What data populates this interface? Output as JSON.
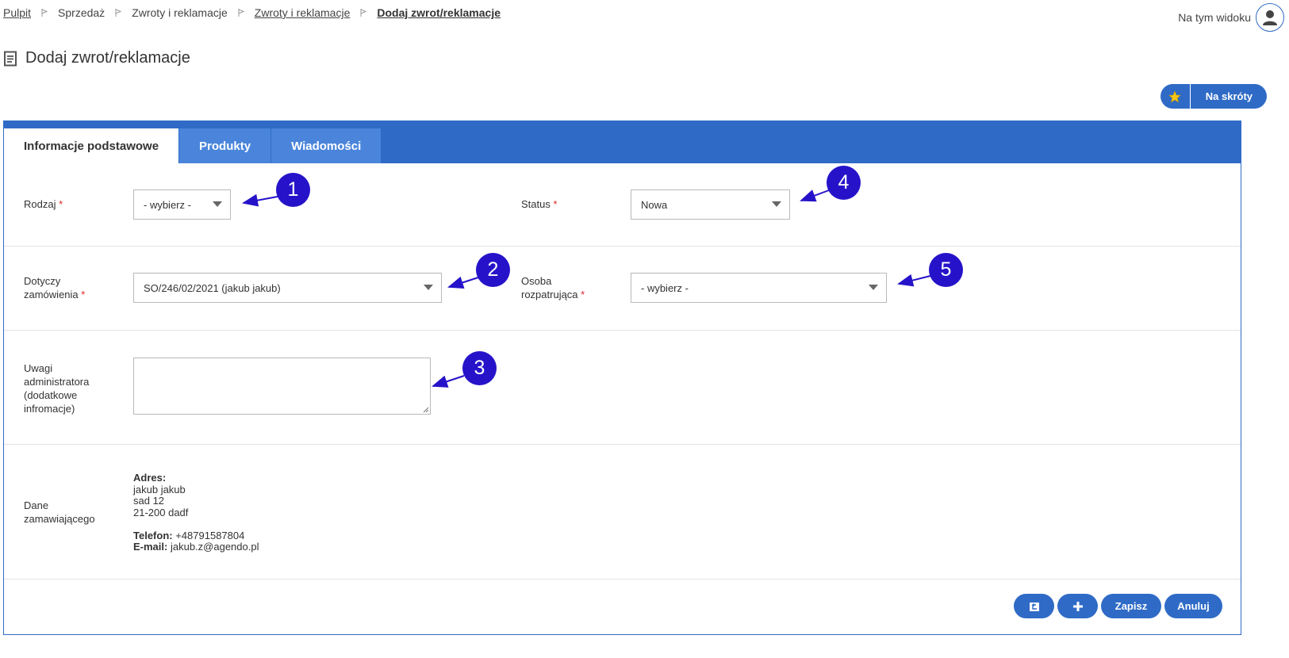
{
  "breadcrumb": {
    "items": [
      {
        "label": "Pulpit"
      },
      {
        "label": "Sprzedaż"
      },
      {
        "label": "Zwroty i reklamacje"
      },
      {
        "label": "Zwroty i reklamacje"
      },
      {
        "label": "Dodaj zwrot/reklamacje"
      }
    ]
  },
  "header": {
    "view_label": "Na tym widoku",
    "avatar_icon": "user-icon",
    "title": "Dodaj zwrot/reklamacje",
    "title_icon": "document-icon"
  },
  "shortcuts": {
    "label": "Na skróty",
    "icon": "star-icon"
  },
  "colors": {
    "accent": "#2f6bc6",
    "callout": "#2613c9",
    "required": "#d9262c"
  },
  "tabs": [
    {
      "label": "Informacje podstawowe",
      "active": true
    },
    {
      "label": "Produkty",
      "active": false
    },
    {
      "label": "Wiadomości",
      "active": false
    }
  ],
  "form": {
    "rodzaj": {
      "label": "Rodzaj",
      "required_mark": "*",
      "value": "- wybierz -"
    },
    "status": {
      "label": "Status",
      "required_mark": "*",
      "value": "Nowa"
    },
    "dotyczy": {
      "label_line1": "Dotyczy",
      "label_line2": "zamówienia",
      "required_mark": "*",
      "value": "SO/246/02/2021 (jakub jakub)"
    },
    "osoba": {
      "label_line1": "Osoba",
      "label_line2": "rozpatrująca",
      "required_mark": "*",
      "value": "- wybierz -"
    },
    "uwagi": {
      "label_lines": [
        "Uwagi",
        "administratora",
        "(dodatkowe",
        "infromacje)"
      ],
      "value": ""
    },
    "dane": {
      "label_line1": "Dane",
      "label_line2": "zamawiającego",
      "address_label": "Adres:",
      "name": "jakub jakub",
      "street": "sad 12",
      "city": "21-200 dadf",
      "phone_label": "Telefon:",
      "phone": "+48791587804",
      "email_label": "E-mail:",
      "email": "jakub.z@agendo.pl"
    }
  },
  "callouts": [
    "1",
    "2",
    "3",
    "4",
    "5"
  ],
  "footer": {
    "back_icon": "return-icon",
    "add_icon": "plus-icon",
    "save_label": "Zapisz",
    "cancel_label": "Anuluj"
  }
}
